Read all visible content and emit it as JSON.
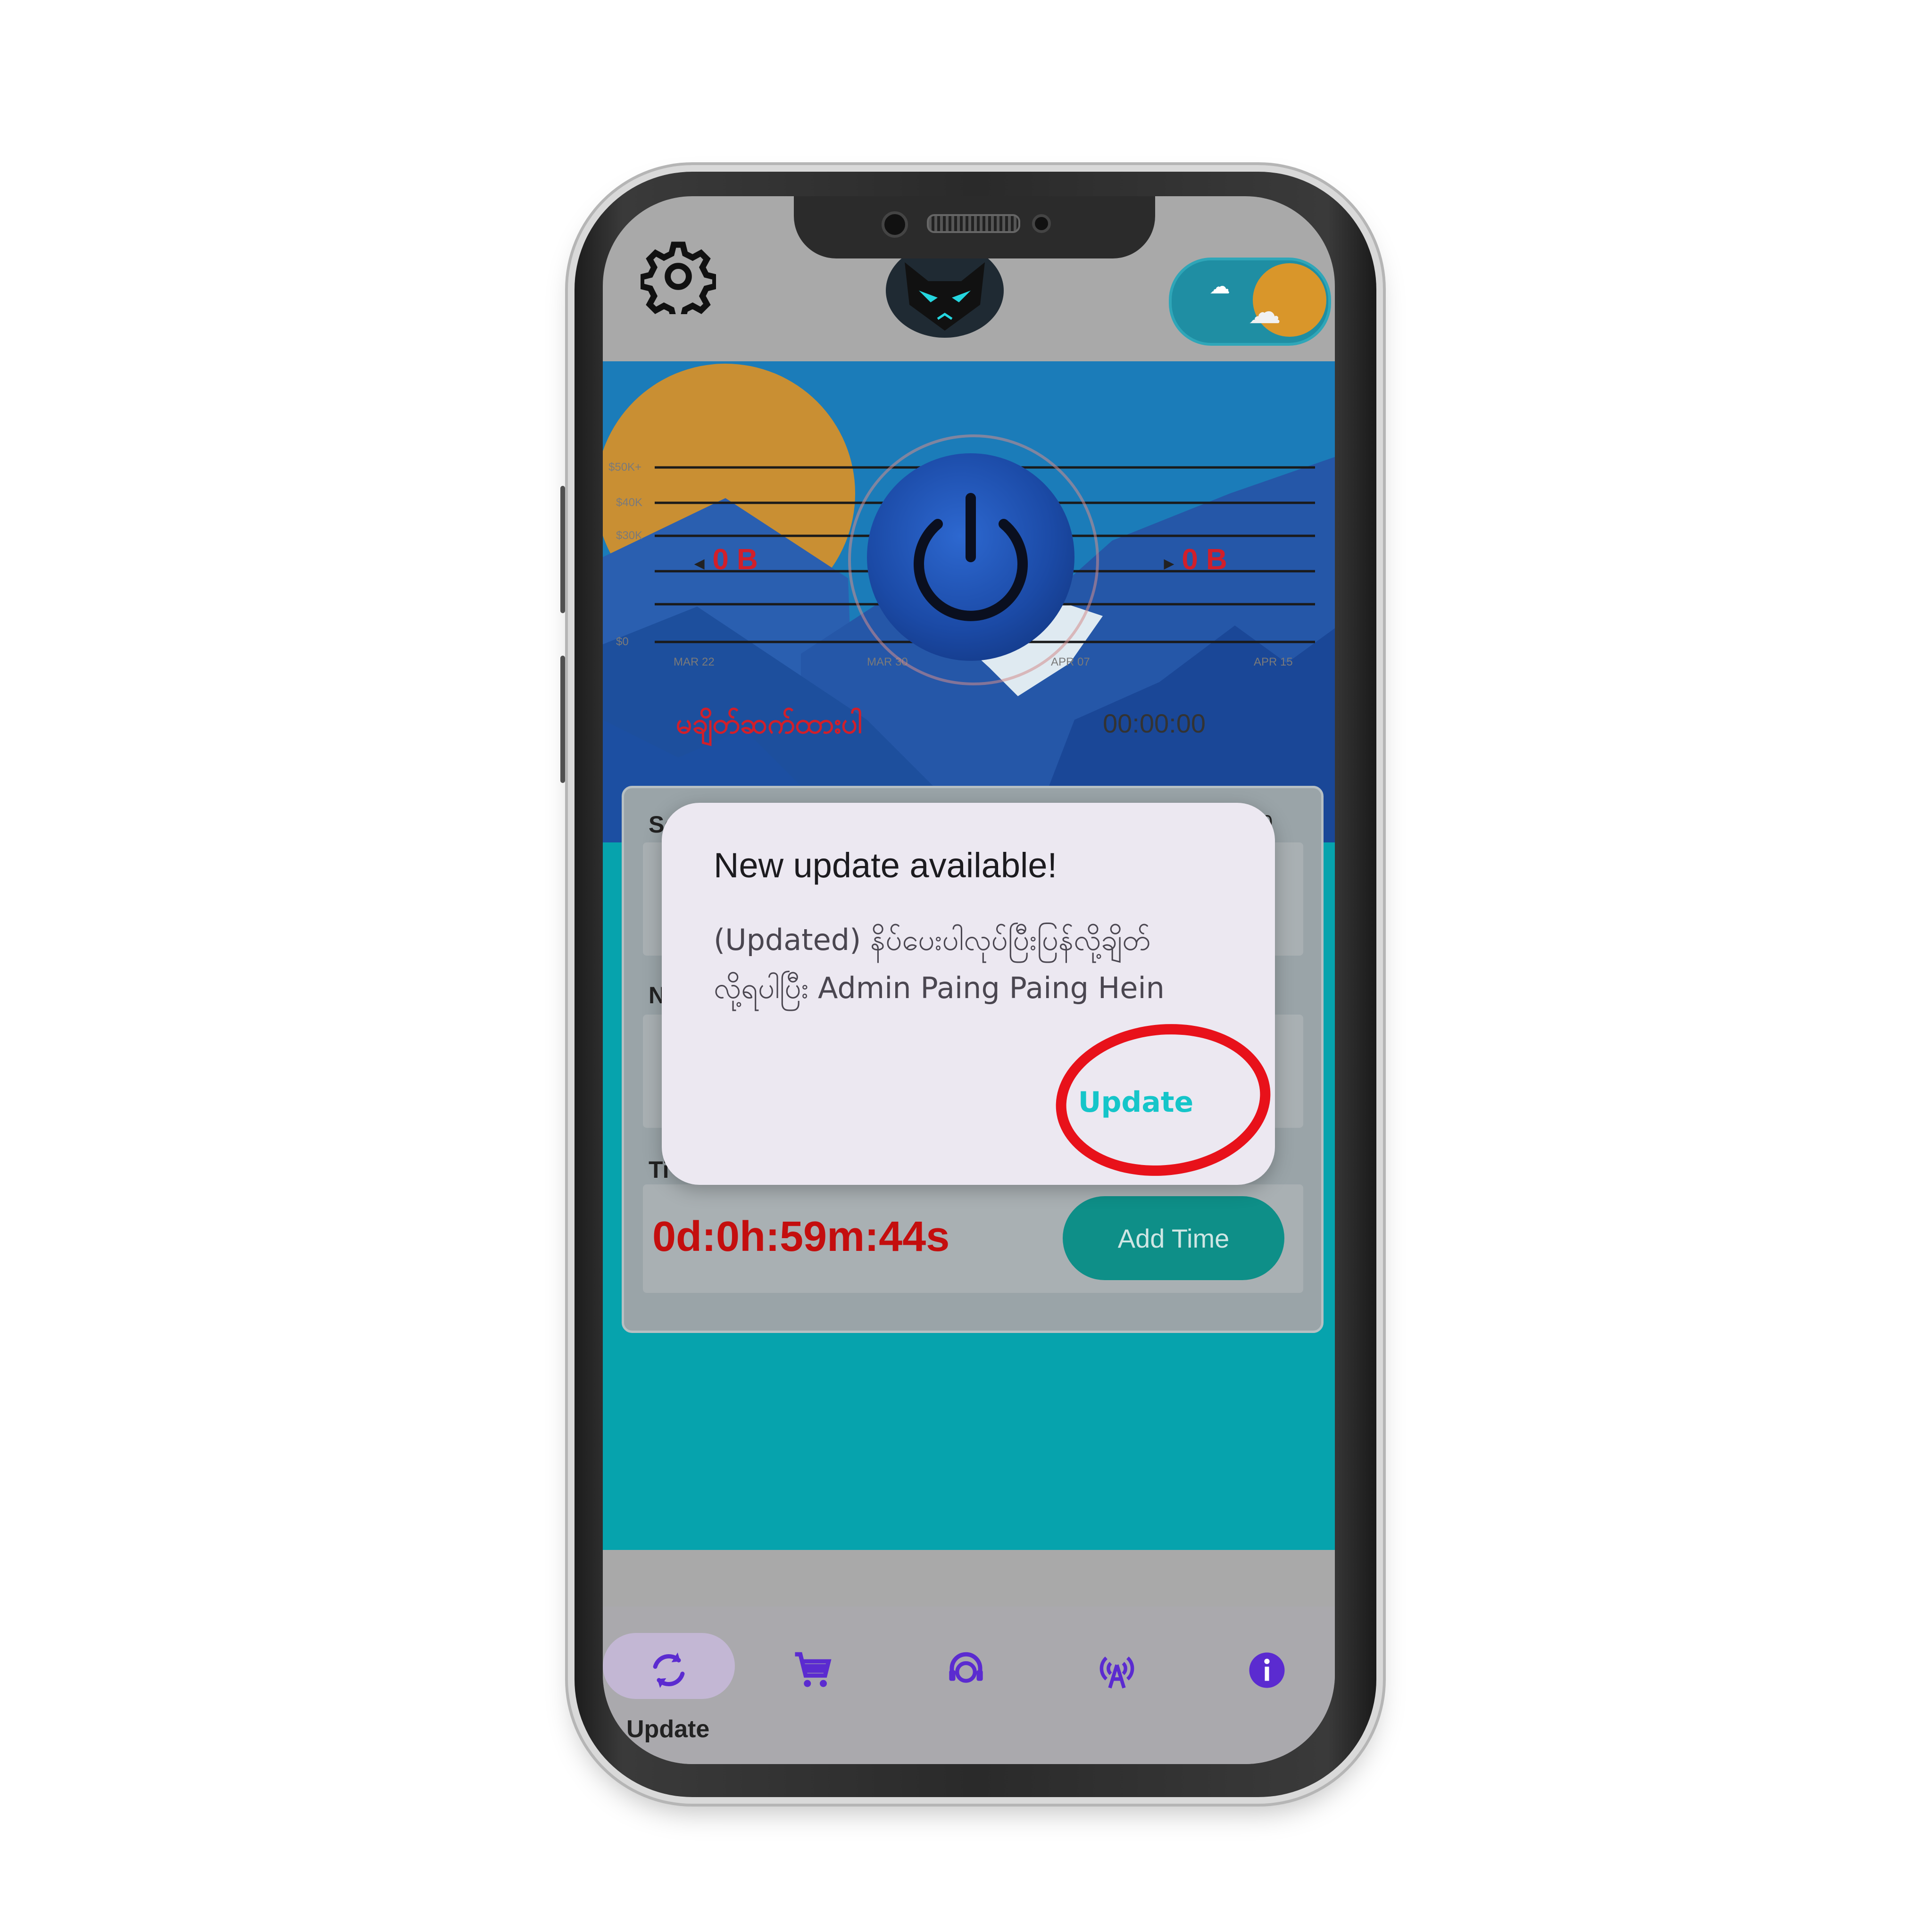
{
  "top_bar": {
    "settings_icon": "gear-icon",
    "logo_icon": "cat-mask-logo-icon",
    "theme_toggle_icon": "day-night-toggle-icon"
  },
  "hero": {
    "download": "0 B",
    "upload": "0 B",
    "connection_status": "မချိတ်ဆက်ထားပါ",
    "connection_timer": "00:00:00",
    "power_icon": "power-icon"
  },
  "card": {
    "server_label": "Se",
    "server_value": ":0",
    "network_label": "N",
    "time_label": "Ti",
    "countdown": "0d:0h:59m:44s",
    "add_time_label": "Add Time"
  },
  "dialog": {
    "title": "New update available!",
    "body_line1": "(Updated) နိပ်ပေးပါလုပ်ပြီးပြန်လို့ချိတ်",
    "body_line2": "လို့ရပါပြီး Admin Paing Paing Hein",
    "button_label": "Update"
  },
  "bottom_nav": {
    "items": [
      {
        "label": "Update",
        "icon": "refresh-icon",
        "active": true
      },
      {
        "label": "",
        "icon": "cart-icon",
        "active": false
      },
      {
        "label": "",
        "icon": "support-agent-icon",
        "active": false
      },
      {
        "label": "",
        "icon": "broadcast-tower-icon",
        "active": false
      },
      {
        "label": "",
        "icon": "info-icon",
        "active": false
      }
    ]
  },
  "colors": {
    "accent_red": "#d21f2a",
    "dialog_button": "#15c5c9",
    "nav_icon": "#5b2bd0",
    "teal_bg": "#06a3ad"
  }
}
